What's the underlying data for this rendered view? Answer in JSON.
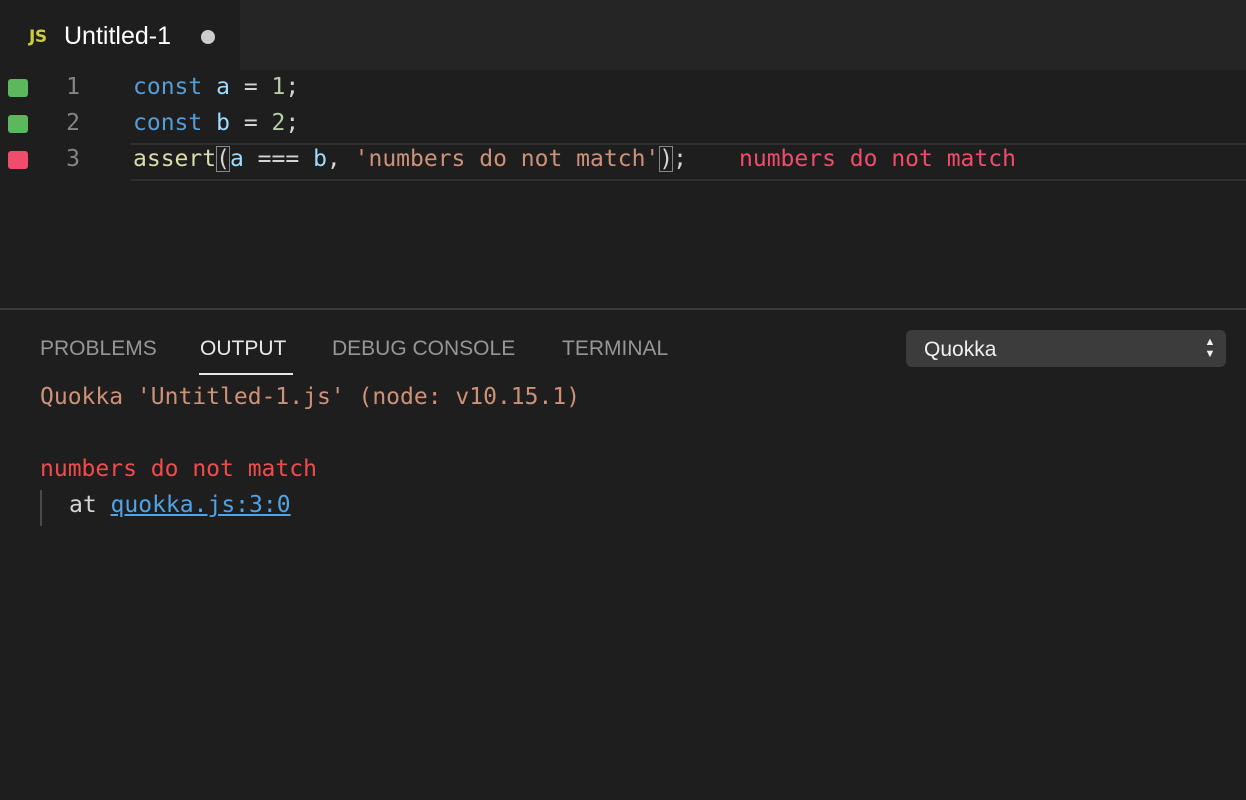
{
  "tab": {
    "icon_text": "JS",
    "title": "Untitled-1"
  },
  "editor": {
    "lines": [
      {
        "number": "1",
        "status": "passed"
      },
      {
        "number": "2",
        "status": "passed"
      },
      {
        "number": "3",
        "status": "failed",
        "inline_message": "numbers do not match"
      }
    ],
    "code": {
      "line1": {
        "kw": "const",
        "var": "a",
        "op": " = ",
        "num": "1",
        "end": ";"
      },
      "line2": {
        "kw": "const",
        "var": "b",
        "op": " = ",
        "num": "2",
        "end": ";"
      },
      "line3": {
        "fn": "assert",
        "open": "(",
        "a": "a",
        "op": " === ",
        "b": "b",
        "comma": ", ",
        "str": "'numbers do not match'",
        "close": ")",
        "end": ";"
      }
    },
    "colors": {
      "passed": "#5cb85c",
      "failed": "#f14c6c"
    }
  },
  "panel": {
    "tabs": [
      {
        "label": "PROBLEMS",
        "active": false
      },
      {
        "label": "OUTPUT",
        "active": true
      },
      {
        "label": "DEBUG CONSOLE",
        "active": false
      },
      {
        "label": "TERMINAL",
        "active": false
      }
    ],
    "channel_select": {
      "value": "Quokka",
      "icon": "updown-arrows-icon"
    },
    "output": {
      "header": "Quokka 'Untitled-1.js' (node: v10.15.1)",
      "error": "numbers do not match",
      "trace_prefix": "at ",
      "trace_link": "quokka.js:3:0"
    }
  }
}
